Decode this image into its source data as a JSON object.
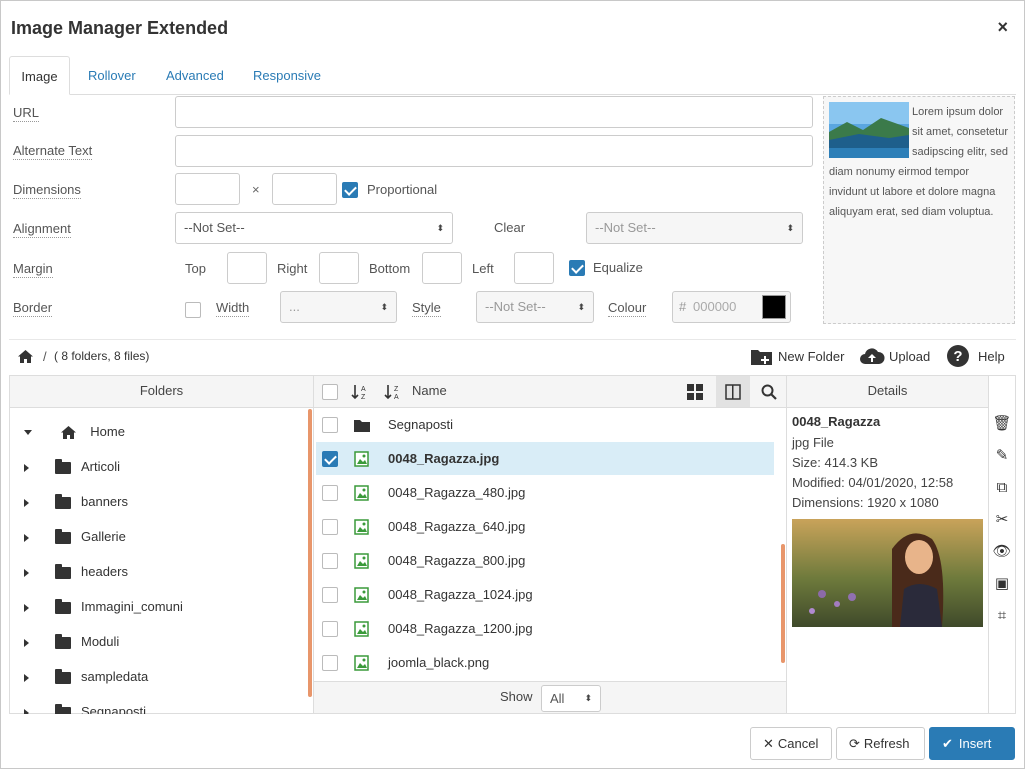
{
  "dialog": {
    "title": "Image Manager Extended",
    "close": "×"
  },
  "tabs": [
    {
      "label": "Image",
      "active": true
    },
    {
      "label": "Rollover"
    },
    {
      "label": "Advanced"
    },
    {
      "label": "Responsive"
    }
  ],
  "form": {
    "url_label": "URL",
    "url_value": "",
    "alt_label": "Alternate Text",
    "alt_value": "",
    "dimensions_label": "Dimensions",
    "dimensions_sep": "×",
    "width_value": "",
    "height_value": "",
    "proportional_label": "Proportional",
    "proportional_checked": true,
    "alignment_label": "Alignment",
    "alignment_value": "--Not Set--",
    "clear_label": "Clear",
    "clear_value": "--Not Set--",
    "margin_label": "Margin",
    "margin_top": "Top",
    "margin_right": "Right",
    "margin_bottom": "Bottom",
    "margin_left": "Left",
    "equalize_label": "Equalize",
    "equalize_checked": true,
    "border_label": "Border",
    "border_checked": false,
    "border_width_label": "Width",
    "border_width_value": "...",
    "border_style_label": "Style",
    "border_style_value": "--Not Set--",
    "border_colour_label": "Colour",
    "border_colour_hash": "#",
    "border_colour_placeholder": "000000",
    "border_colour_swatch": "#000000"
  },
  "preview": {
    "text": "Lorem ipsum dolor sit amet, consetetur sadipscing elitr, sed diam nonumy eirmod tempor invidunt ut labore et dolore magna aliquyam erat, sed diam voluptua."
  },
  "breadcrumb": {
    "sep": "/",
    "info": "( 8 folders, 8 files)"
  },
  "toolbar": {
    "new_folder": "New Folder",
    "upload": "Upload",
    "help": "Help"
  },
  "folders": {
    "header": "Folders",
    "items": [
      "Home",
      "Articoli",
      "banners",
      "Gallerie",
      "headers",
      "Immagini_comuni",
      "Moduli",
      "sampledata",
      "Segnaposti"
    ]
  },
  "files": {
    "name_header": "Name",
    "items": [
      {
        "name": "Segnaposti",
        "type": "folder",
        "checked": false
      },
      {
        "name": "0048_Ragazza.jpg",
        "type": "image",
        "checked": true
      },
      {
        "name": "0048_Ragazza_480.jpg",
        "type": "image",
        "checked": false
      },
      {
        "name": "0048_Ragazza_640.jpg",
        "type": "image",
        "checked": false
      },
      {
        "name": "0048_Ragazza_800.jpg",
        "type": "image",
        "checked": false
      },
      {
        "name": "0048_Ragazza_1024.jpg",
        "type": "image",
        "checked": false
      },
      {
        "name": "0048_Ragazza_1200.jpg",
        "type": "image",
        "checked": false
      },
      {
        "name": "joomla_black.png",
        "type": "image",
        "checked": false
      }
    ],
    "show_label": "Show",
    "show_value": "All"
  },
  "details": {
    "header": "Details",
    "name": "0048_Ragazza",
    "type": "jpg File",
    "size": "Size: 414.3 KB",
    "modified": "Modified: 04/01/2020, 12:58",
    "dimensions": "Dimensions: 1920 x 1080"
  },
  "buttons": {
    "cancel": "Cancel",
    "refresh": "Refresh",
    "insert": "Insert"
  },
  "colors": {
    "accent": "#2a7bb5",
    "selected_row": "#d9edf7",
    "scroll": "#e8966b"
  }
}
